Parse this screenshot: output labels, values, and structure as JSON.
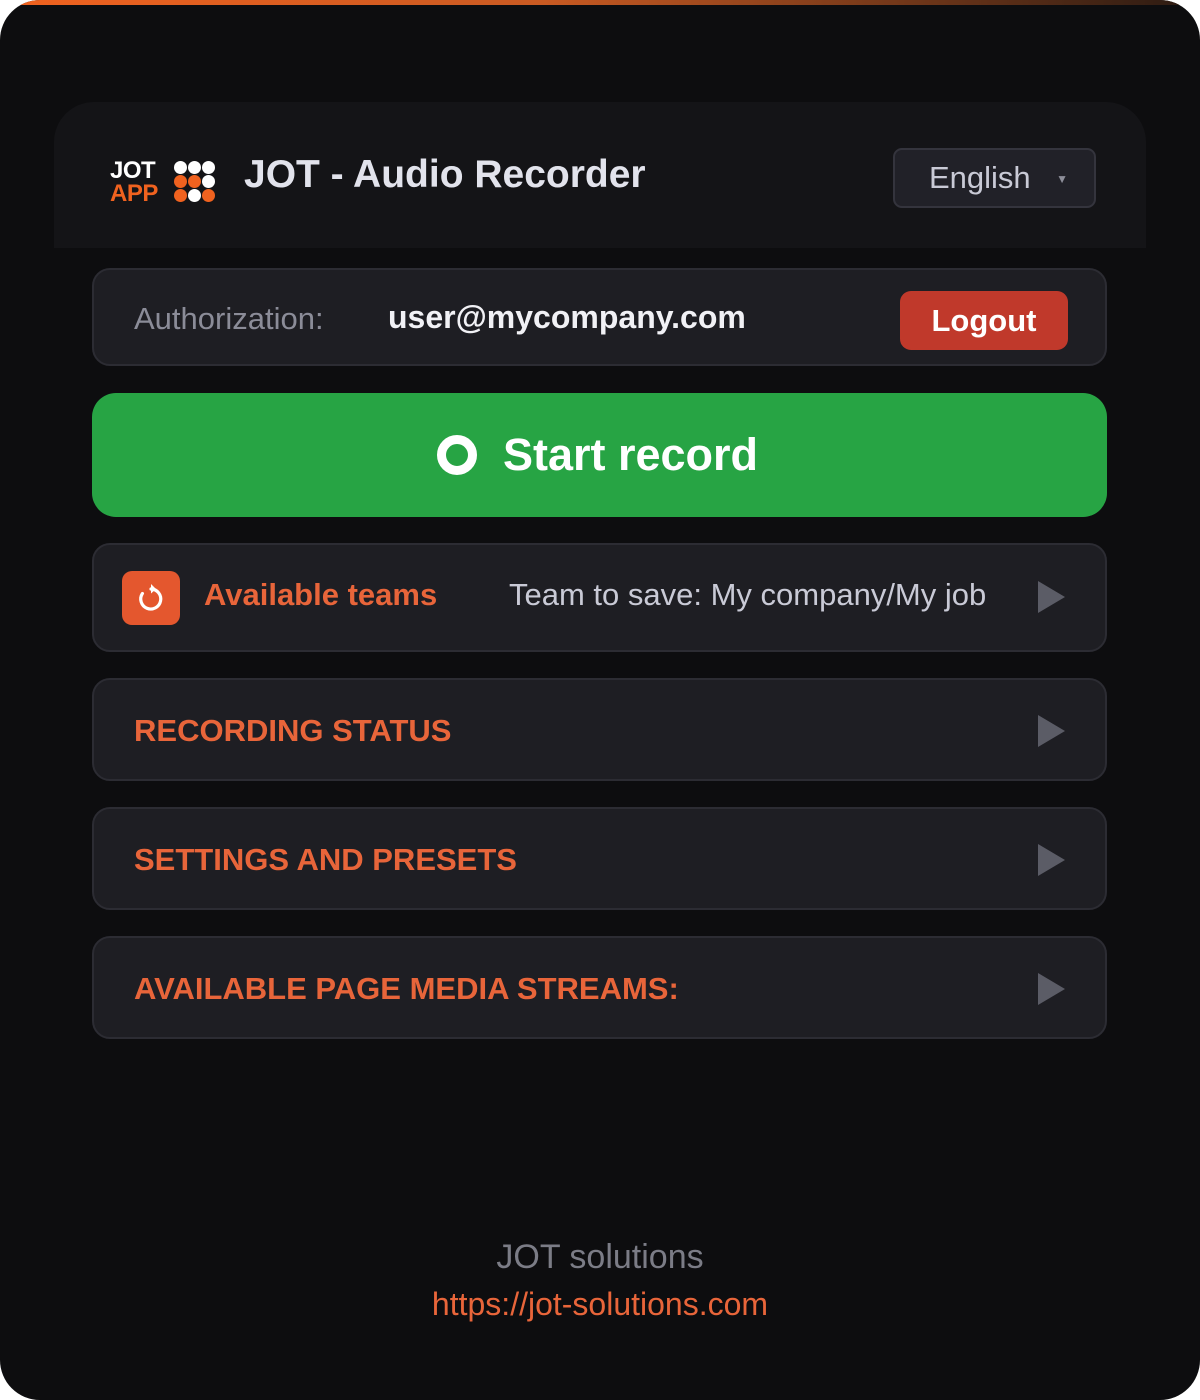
{
  "colors": {
    "accent": "#f0621f",
    "background": "#0d0d0f",
    "card": "#1e1e23",
    "record_green": "#27a444",
    "logout_red": "#c0392b",
    "section_orange": "#e8653a"
  },
  "header": {
    "logo_line1": "JOT",
    "logo_line2": "APP",
    "title": "JOT - Audio Recorder",
    "language": {
      "selected": "English",
      "icon": "caret-down-icon"
    }
  },
  "auth": {
    "label": "Authorization:",
    "email": "user@mycompany.com",
    "logout_label": "Logout"
  },
  "record": {
    "label": "Start record",
    "icon": "record-circle-icon"
  },
  "teams": {
    "icon": "refresh-icon",
    "label": "Available teams",
    "team_to_save": "Team to save: My company/My job",
    "arrow_icon": "chevron-right-icon"
  },
  "sections": [
    {
      "title": "RECORDING STATUS",
      "icon": "chevron-right-icon"
    },
    {
      "title": "SETTINGS AND PRESETS",
      "icon": "chevron-right-icon"
    },
    {
      "title": "AVAILABLE PAGE MEDIA STREAMS:",
      "icon": "chevron-right-icon"
    }
  ],
  "footer": {
    "company": "JOT solutions",
    "link": "https://jot-solutions.com"
  }
}
